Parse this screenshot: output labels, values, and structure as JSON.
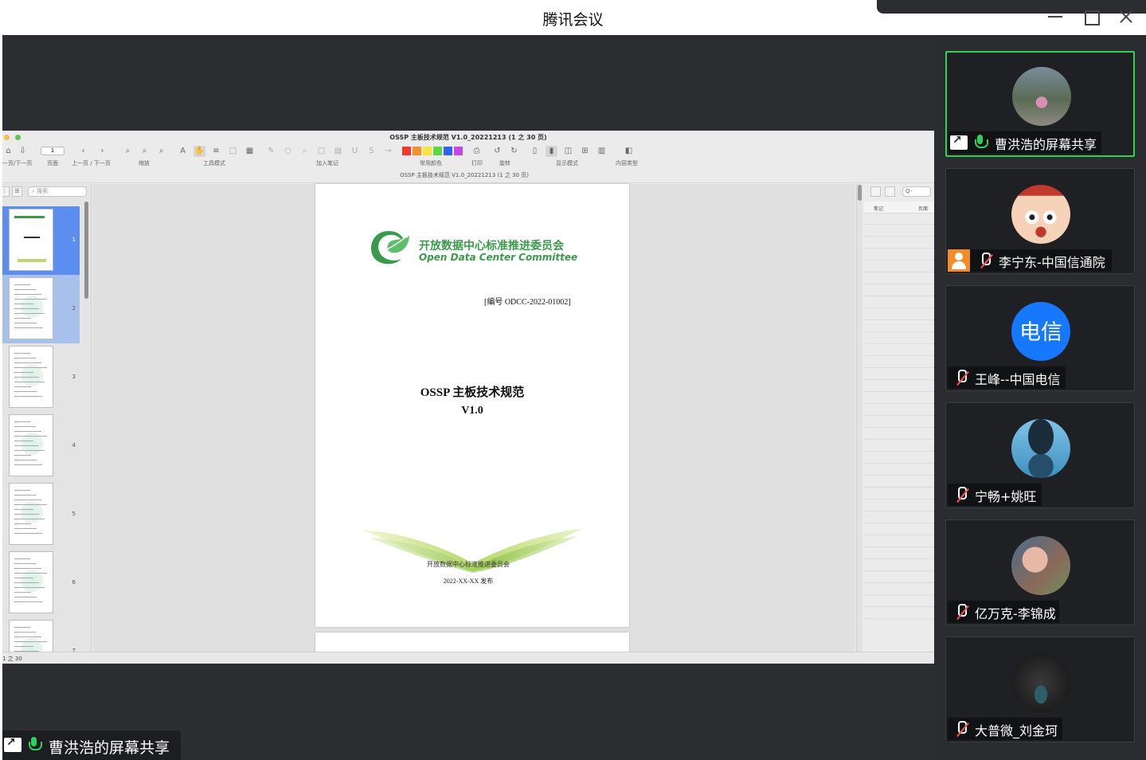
{
  "window": {
    "title": "腾讯会议"
  },
  "pdf": {
    "window_title": "OSSP 主板技术规范 V1.0_20221213 (1 之 30 页)",
    "subtitle": "OSSP 主板技术规范 V1.0_20221213 (1 之 30 页)",
    "page_input": "1",
    "toolbar_labels": {
      "prev_next_page": "一页/下一页",
      "page": "页面",
      "prev_next": "上一页 / 下一页",
      "zoom": "缩放",
      "tool_mode": "工具模式",
      "add_note": "加入笔记",
      "common_colors": "常用颜色",
      "print": "打印",
      "rotate": "旋转",
      "display_mode": "显示模式",
      "content_type": "内容类型"
    },
    "swatch_colors": [
      "#f23a2e",
      "#f5912c",
      "#f6e43a",
      "#5fd445",
      "#2d63f0",
      "#c447e8"
    ],
    "thumb_search_placeholder": "搜索",
    "thumb_pages": [
      "1",
      "2",
      "3",
      "4",
      "5",
      "6",
      "7"
    ],
    "notes_search": "Q- ",
    "notes_header": {
      "notes": "笔记",
      "page": "页面"
    },
    "status": "1 之 30",
    "document": {
      "org_cn": "开放数据中心标准推进委员会",
      "org_en": "Open Data Center Committee",
      "number": "[编号 ODCC-2022-01002]",
      "title": "OSSP 主板技术规范",
      "version": "V1.0",
      "publisher": "开放数据中心标准推进委员会",
      "date": "2022-XX-XX 发布"
    }
  },
  "share_tag": {
    "label": "曹洪浩的屏幕共享"
  },
  "participants": [
    {
      "name": "曹洪浩的屏幕共享",
      "speaking": true,
      "avatar": "photo-child"
    },
    {
      "name": "李宁东-中国信通院",
      "avatar": "cartoon"
    },
    {
      "name": "王峰--中国电信",
      "avatar": "text-badge",
      "avatar_text": "电信",
      "avatar_color": "#1677ff"
    },
    {
      "name": "宁畅+姚旺",
      "avatar": "photo-hat"
    },
    {
      "name": "亿万克-李锦成",
      "avatar": "photo-baby"
    },
    {
      "name": "大普微_刘金珂",
      "avatar": "photo-cave"
    }
  ]
}
